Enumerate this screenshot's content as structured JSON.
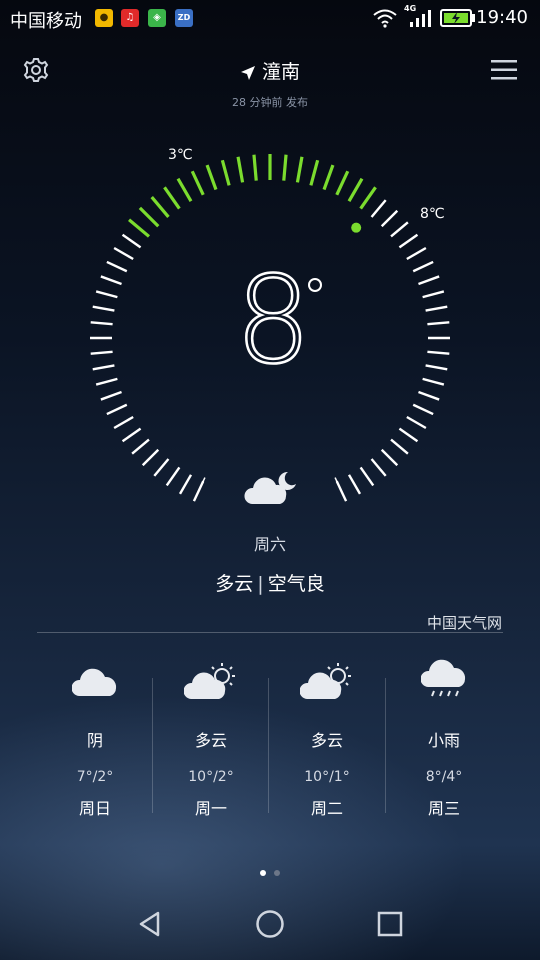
{
  "status_bar": {
    "carrier": "中国移动",
    "app_icons": [
      {
        "name": "stock-app-icon",
        "color": "#f2b800",
        "glyph": "●"
      },
      {
        "name": "music-app-icon",
        "color": "#e02a2a",
        "glyph": "♫"
      },
      {
        "name": "gallery-app-icon",
        "color": "#3bb54a",
        "glyph": "◈"
      },
      {
        "name": "zd-app-icon",
        "color": "#3a6fc4",
        "glyph": "ZD"
      }
    ],
    "network": "4G",
    "time": "19:40"
  },
  "header": {
    "city": "潼南",
    "published": "28 分钟前 发布"
  },
  "gauge": {
    "low_label": "3℃",
    "high_label": "8℃",
    "low": 3,
    "high": 8,
    "current": 8,
    "unit_symbol": "°",
    "active_color": "#7bdc2e"
  },
  "today": {
    "day": "周六",
    "condition": "多云",
    "air_quality": "空气良",
    "icon": "cloud-moon-icon"
  },
  "source": "中国天气网",
  "forecast": [
    {
      "condition": "阴",
      "temp": "7°/2°",
      "day": "周日",
      "icon": "cloud-icon"
    },
    {
      "condition": "多云",
      "temp": "10°/2°",
      "day": "周一",
      "icon": "cloud-sun-icon"
    },
    {
      "condition": "多云",
      "temp": "10°/1°",
      "day": "周二",
      "icon": "cloud-sun-icon"
    },
    {
      "condition": "小雨",
      "temp": "8°/4°",
      "day": "周三",
      "icon": "rain-icon"
    }
  ],
  "pager": {
    "pages": 2,
    "active": 0
  }
}
